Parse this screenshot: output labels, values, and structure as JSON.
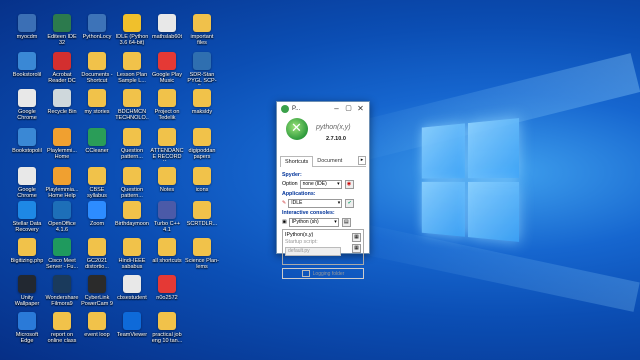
{
  "desktop": {
    "icons": [
      {
        "label": "myocdm",
        "color": "#3b6fb5"
      },
      {
        "label": "Editeen IDE 32",
        "color": "#2c7a4d"
      },
      {
        "label": "PythonLocy",
        "color": "#3d73b8"
      },
      {
        "label": "IDLE (Python 3.6 64-bit)",
        "color": "#f0c02c"
      },
      {
        "label": "mathslab60t",
        "color": "#e8e8e8"
      },
      {
        "label": "important files",
        "color": "#f0c14b"
      },
      {
        "label": "Bookstorolil",
        "color": "#3a88d5"
      },
      {
        "label": "Acrobat Reader DC",
        "color": "#d32f2f"
      },
      {
        "label": "Documents - Shortcut",
        "color": "#f1c24a"
      },
      {
        "label": "Lesson Plan Sample L...",
        "color": "#f1c24a"
      },
      {
        "label": "Google Play Music",
        "color": "#e53935"
      },
      {
        "label": "SDR-Stan PYGL SCP-5...",
        "color": "#2f6fb0"
      },
      {
        "label": "Google Chrome",
        "color": "#e8e8e8"
      },
      {
        "label": "Recycle Bin",
        "color": "#cfd8dc"
      },
      {
        "label": "my stories",
        "color": "#f1c24a"
      },
      {
        "label": "BDCHMCN TECHNOLO...",
        "color": "#f1c24a"
      },
      {
        "label": "Project on Tedelik",
        "color": "#f1c24a"
      },
      {
        "label": "maksldy",
        "color": "#f1c24a"
      },
      {
        "label": "Bookstopolil",
        "color": "#3a88d5"
      },
      {
        "label": "Playlemmi... Home",
        "color": "#f0a030"
      },
      {
        "label": "CCleaner",
        "color": "#2a9d58"
      },
      {
        "label": "Question pattern...",
        "color": "#f1c24a"
      },
      {
        "label": "ATTENDANCE RECORD X...",
        "color": "#f1c24a"
      },
      {
        "label": "digipoddan papers",
        "color": "#f1c24a"
      },
      {
        "label": "Google Chrome",
        "color": "#e8e8e8"
      },
      {
        "label": "Playlemmia... Home Help",
        "color": "#f0a030"
      },
      {
        "label": "CBSE syllabus",
        "color": "#f1c24a"
      },
      {
        "label": "Question pattern...",
        "color": "#f1c24a"
      },
      {
        "label": "Notes",
        "color": "#f1c24a"
      },
      {
        "label": "icons",
        "color": "#f1c24a"
      },
      {
        "label": "Stellar Data Recovery",
        "color": "#1e88e5"
      },
      {
        "label": "OpenOffice 4.1.6",
        "color": "#1d6fb8"
      },
      {
        "label": "Zoom",
        "color": "#2d8cff"
      },
      {
        "label": "Birthdaymoon",
        "color": "#f1c24a"
      },
      {
        "label": "Turbo C++ 4.1",
        "color": "#4b5aa8"
      },
      {
        "label": "SCRTDLR...",
        "color": "#f1c24a"
      },
      {
        "label": "Bigitizing.php",
        "color": "#f1c24a"
      },
      {
        "label": "Cisco Meet Server - Fu...",
        "color": "#1f9a5e"
      },
      {
        "label": "GC2021 distortio...",
        "color": "#f1c24a"
      },
      {
        "label": "Hindi-IEEE sababus",
        "color": "#f1c24a"
      },
      {
        "label": "all shortcuts",
        "color": "#f1c24a"
      },
      {
        "label": "Science Plan-lems",
        "color": "#f1c24a"
      },
      {
        "label": "Unity Wallpaper",
        "color": "#222831"
      },
      {
        "label": "Wondershare Filmora9",
        "color": "#1a3a5c"
      },
      {
        "label": "CyberLink PowerCam 9",
        "color": "#2b2b2b"
      },
      {
        "label": "cbsestudent",
        "color": "#e8e8e8"
      },
      {
        "label": "n0o2572",
        "color": "#e53935"
      },
      {
        "label": "Microsoft Edge",
        "color": "#2a7ad8"
      },
      {
        "label": "report on online class",
        "color": "#f1c24a"
      },
      {
        "label": "event loop",
        "color": "#f1c24a"
      },
      {
        "label": "TeamViewer",
        "color": "#0e6ad9"
      },
      {
        "label": "practical job eng 10 tan...",
        "color": "#f1c24a"
      }
    ]
  },
  "window": {
    "title": "P...",
    "app_name": "python(x,y)",
    "version": "2.7.10.0",
    "tabs": [
      "Shortcuts",
      "Document"
    ],
    "tab_arrow": "▸",
    "spyder_label": "Spyder:",
    "option_label": "Option",
    "spyder_option": "none (IDE)",
    "applications_label": "Applications:",
    "app_value": "IDLE",
    "consoles_label": "Interactive consoles:",
    "console_value": "IPython (sh)",
    "console_name": "IPython(x,y)",
    "startup_label": "Startup script:",
    "startup_value": "default.py",
    "logging_button": "Logging folder"
  },
  "colors": {
    "section_header": "#003399"
  }
}
